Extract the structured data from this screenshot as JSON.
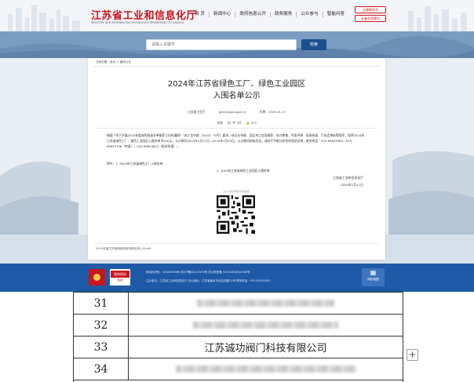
{
  "header": {
    "site_title": "江苏省工业和信息化厅",
    "site_subtitle": "INDUSTRY AND INFORMATION TECHNOLOGY DEPARTMENT OF JIANGSU",
    "nav": [
      "首 页",
      "新闻中心",
      "政府信息公开",
      "政务服务",
      "公众参与",
      "智能问答"
    ],
    "buttons": [
      "无障碍浏览",
      "长者浏览模式"
    ]
  },
  "search": {
    "placeholder": "请输入关键字",
    "button_label": "检索"
  },
  "article": {
    "breadcrumb": "当前位置：首页 > 通知公告",
    "title_line1": "2024年江苏省绿色工厂、绿色工业园区",
    "title_line2": "入围名单公示",
    "source": "江苏省工信厅",
    "url": "gxt.jiangsu.gov.cn",
    "date": "日期：2025-01-17",
    "font_label": "字体：【大 中 小】",
    "views": "🔒 270",
    "body": "根据《关于开展2024年度绿色制造名单推荐工作的通知》（苏工信节能〔2024〕70号）要求，经企业申报、设区市工信局推荐、形式审查、专家评审、现场核查、厅务会审核等程序，现将2024年江苏省绿色工厂、绿色工业园区入围名单予以公示。公示期为2025年1月17日—2025年1月23日，公示期间如有异议，请向厅节能与综合利用处反映，联系电话：025-69653963；025-69653706（传真）；025-69653813（投诉举报）。",
    "attachments": [
      "附件：1. 2024年江苏省绿色工厂入围名单",
      "2. 2024年江苏省绿色工业园区入围名单"
    ],
    "signature_org": "江苏省工业和信息化厅",
    "signature_date": "2025年1月17日",
    "qr_label": "扫一扫在手机打开当前页",
    "footer_note": "2024年度江苏省绿色制造申报名单公示.pdf"
  },
  "site_footer": {
    "gov_badge_top": "政府网站",
    "gov_badge_bottom": "找错",
    "row1": "网站标识码：3200000069    苏ICP备05013570号    苏公网安备 32010602010365号",
    "row2": "主办单位：江苏省工业和信息化厅    办公地址：江苏省南京市北京西路70号    联系电话：025-83300000",
    "right_label": "网站地图"
  },
  "table": {
    "rows": [
      {
        "num": "31",
        "name": "",
        "redacted": true
      },
      {
        "num": "32",
        "name": "",
        "redacted": true
      },
      {
        "num": "33",
        "name": "江苏诚功阀门科技有限公司",
        "redacted": false
      },
      {
        "num": "34",
        "name": "",
        "redacted": true
      }
    ]
  },
  "colors": {
    "brand_red": "#c8161d",
    "footer_blue": "#1f5aa6",
    "search_blue": "#1d4f91"
  },
  "icons": {
    "expand": "plus-icon",
    "views": "eye-icon"
  }
}
